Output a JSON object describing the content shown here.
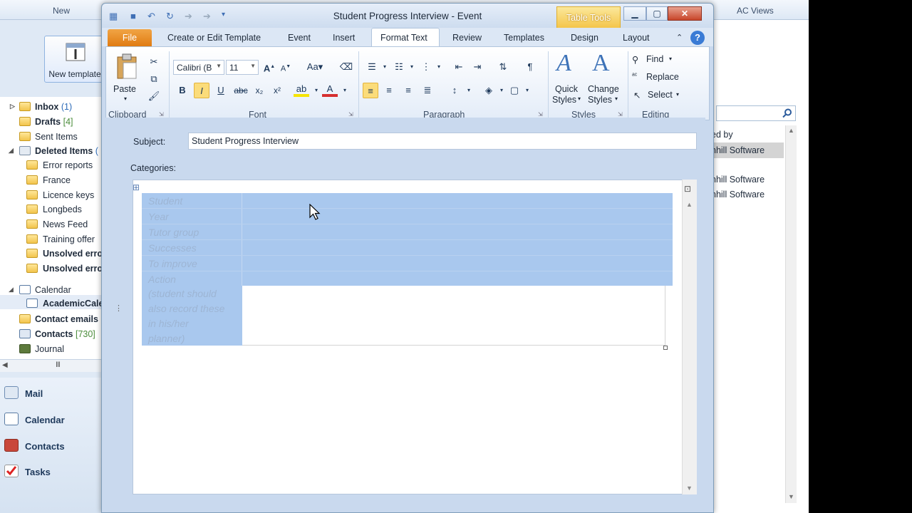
{
  "background_app": {
    "groups": [
      "New",
      "AC Views"
    ],
    "new_template_label": "New template",
    "folders": [
      {
        "label": "Inbox",
        "count": "(1)"
      },
      {
        "label": "Drafts",
        "count": "[4]"
      },
      {
        "label": "Sent Items",
        "count": ""
      },
      {
        "label": "Deleted Items",
        "count": "("
      },
      {
        "label": "Error reports",
        "count": ""
      },
      {
        "label": "France",
        "count": ""
      },
      {
        "label": "Licence keys",
        "count": ""
      },
      {
        "label": "Longbeds",
        "count": ""
      },
      {
        "label": "News Feed",
        "count": ""
      },
      {
        "label": "Training offer",
        "count": ""
      },
      {
        "label": "Unsolved erro",
        "count": ""
      },
      {
        "label": "Unsolved erro",
        "count": ""
      },
      {
        "label": "Calendar",
        "count": ""
      },
      {
        "label": "AcademicCale",
        "count": ""
      },
      {
        "label": "Contact emails",
        "count": ""
      },
      {
        "label": "Contacts",
        "count": "[730]"
      },
      {
        "label": "Journal",
        "count": ""
      }
    ],
    "nav_buttons": [
      "Mail",
      "Calendar",
      "Contacts",
      "Tasks"
    ],
    "right_pane": {
      "header": "ed by",
      "rows": [
        "nhill Software",
        "nhill Software",
        "nhill Software"
      ]
    }
  },
  "window": {
    "title": "Student Progress Interview  -  Event",
    "contextual_tab": "Table Tools",
    "tabs": [
      "File",
      "Create or Edit Template",
      "Event",
      "Insert",
      "Format Text",
      "Review",
      "Templates",
      "Design",
      "Layout"
    ],
    "active_tab": "Format Text"
  },
  "ribbon": {
    "clipboard": {
      "paste": "Paste",
      "group": "Clipboard"
    },
    "font": {
      "name": "Calibri (B",
      "size": "11",
      "group": "Font"
    },
    "paragraph": {
      "group": "Paragraph"
    },
    "styles": {
      "quick": "Quick",
      "quick2": "Styles",
      "change": "Change",
      "change2": "Styles",
      "group": "Styles"
    },
    "editing": {
      "find": "Find",
      "replace": "Replace",
      "select": "Select",
      "group": "Editing"
    }
  },
  "form": {
    "subject_label": "Subject:",
    "subject_value": "Student Progress Interview",
    "categories_label": "Categories:"
  },
  "table_rows": [
    "Student",
    "Year",
    "Tutor group",
    "Successes",
    "To improve",
    "Action",
    "(student should",
    "also record these",
    "in his/her",
    "planner)"
  ]
}
